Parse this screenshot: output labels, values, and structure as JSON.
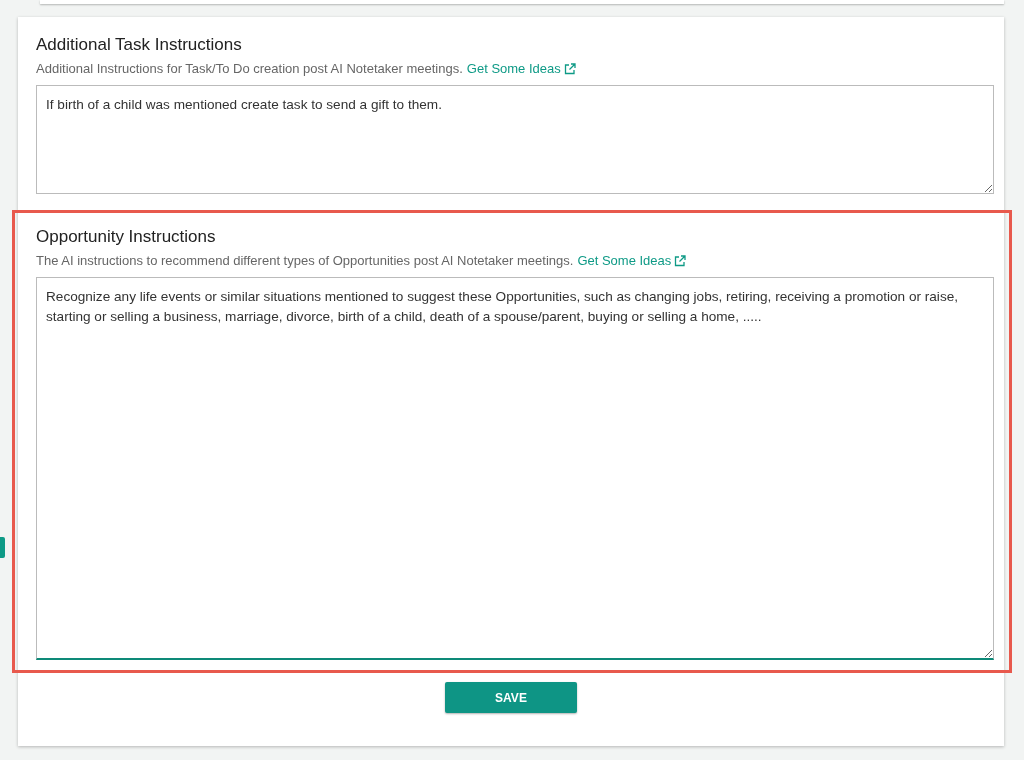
{
  "sections": [
    {
      "title": "Additional Task Instructions",
      "description": "Additional Instructions for Task/To Do creation post AI Notetaker meetings.",
      "link": "Get Some Ideas",
      "value": "If birth of a child was mentioned create task to send a gift to them.",
      "focused": false,
      "highlighted": false,
      "kind": "short"
    },
    {
      "title": "Opportunity Instructions",
      "description": "The AI instructions to recommend different types of Opportunities post AI Notetaker meetings.",
      "link": "Get Some Ideas",
      "value": "Recognize any life events or similar situations mentioned to suggest these Opportunities, such as changing jobs, retiring, receiving a promotion or raise, starting or selling a business, marriage, divorce, birth of a child, death of a spouse/parent, buying or selling a home, .....",
      "focused": true,
      "highlighted": true,
      "kind": "tall"
    }
  ],
  "save_button": "SAVE"
}
